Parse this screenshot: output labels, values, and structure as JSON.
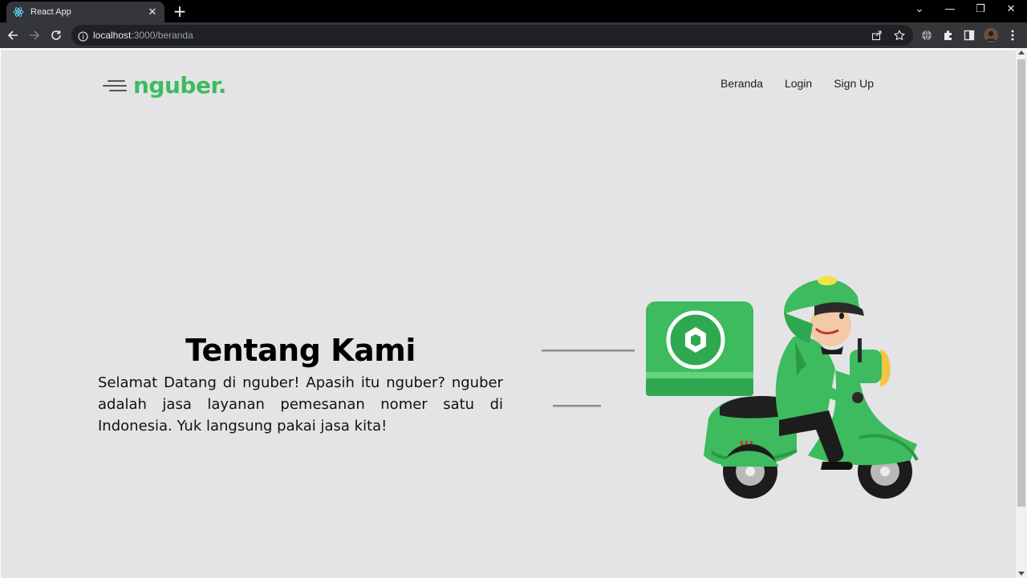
{
  "browser": {
    "tab_title": "React App",
    "url_host": "localhost",
    "url_path": ":3000/beranda"
  },
  "navbar": {
    "logo_text": "nguber.",
    "items": [
      {
        "label": "Beranda"
      },
      {
        "label": "Login"
      },
      {
        "label": "Sign Up"
      }
    ]
  },
  "about": {
    "title": "Tentang Kami",
    "body": "Selamat Datang di nguber! Apasih itu nguber? nguber adalah jasa layanan pemesanan nomer satu di Indonesia. Yuk langsung pakai jasa kita!"
  },
  "colors": {
    "brand_green": "#3dbb5e",
    "page_background": "#e4e4e7"
  },
  "icons": {
    "hero": "delivery-scooter-illustration"
  }
}
